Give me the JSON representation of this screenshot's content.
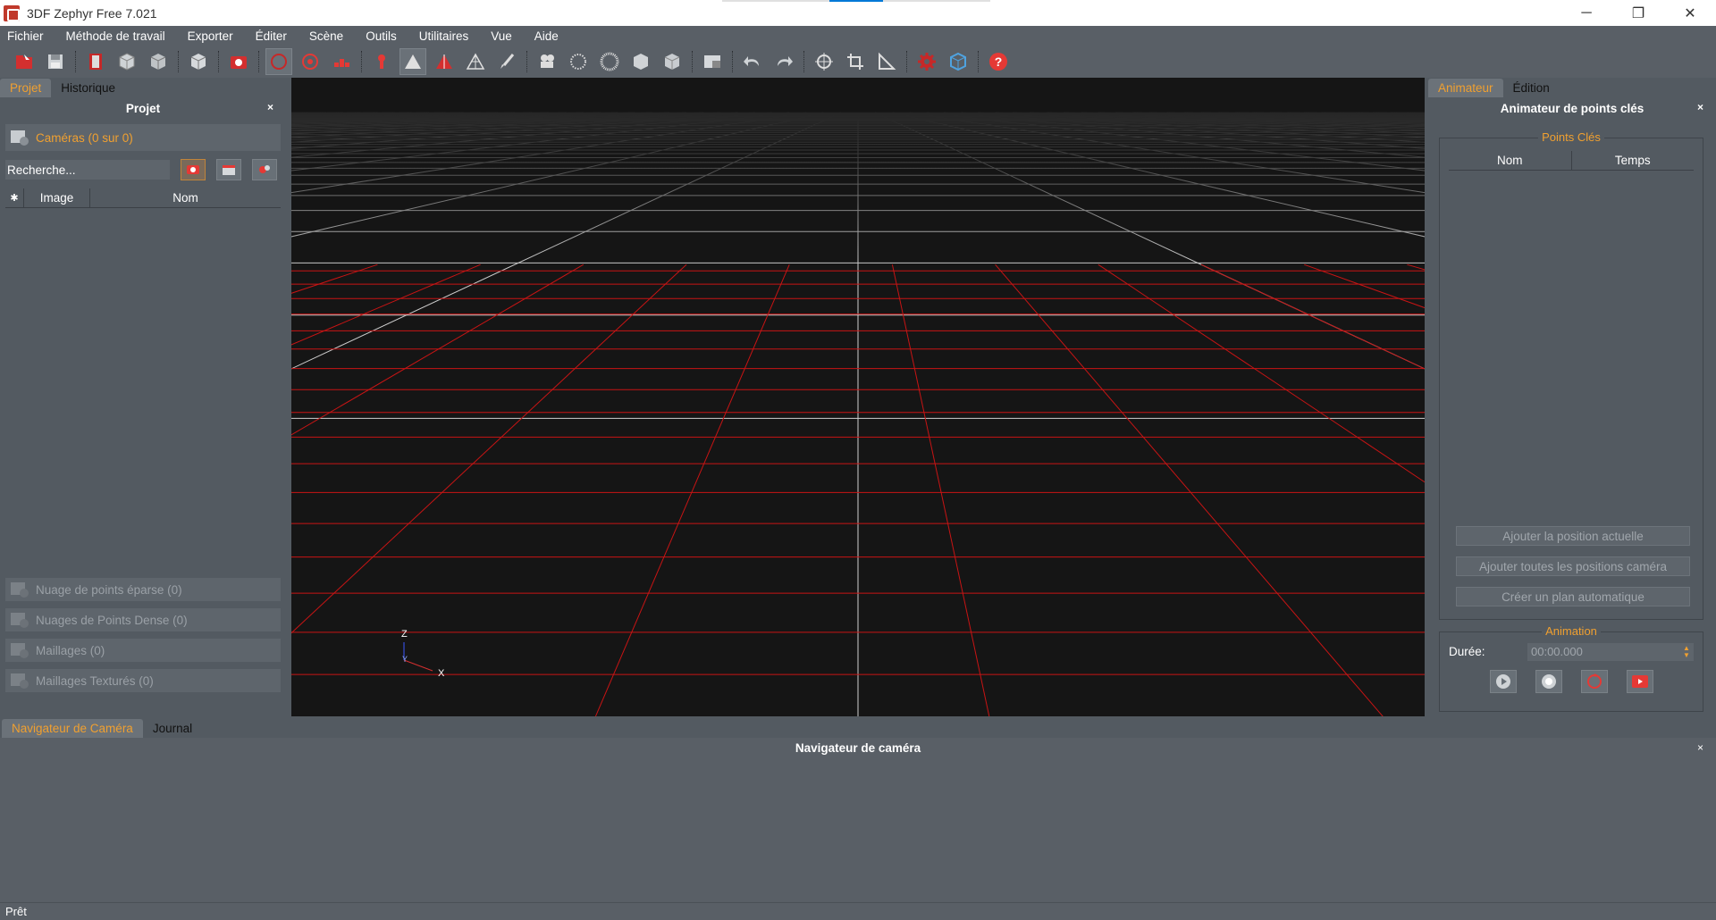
{
  "window": {
    "title": "3DF Zephyr Free 7.021",
    "controls": [
      "─",
      "❐",
      "✕"
    ]
  },
  "menubar": [
    "Fichier",
    "Méthode de travail",
    "Exporter",
    "Éditer",
    "Scène",
    "Outils",
    "Utilitaires",
    "Vue",
    "Aide"
  ],
  "toolbar": {
    "icons": [
      "new-project-icon",
      "save-icon",
      "film-icon",
      "cube-icon",
      "cube-solid-icon",
      "export-cube-icon",
      "camera-icon",
      "orbit-icon",
      "target-icon",
      "sparse-points-icon",
      "mesh-icon",
      "triangle-icon",
      "triangle-red-icon",
      "triangle-outline-icon",
      "brush-icon",
      "camera-rig-icon",
      "points-icon",
      "dense-points-icon",
      "solid-cube-icon",
      "textured-cube-icon",
      "window-icon",
      "undo-icon",
      "redo-icon",
      "rotate-icon",
      "crop-icon",
      "ruler-icon",
      "settings-icon",
      "view-cube-icon",
      "help-icon"
    ]
  },
  "left_panel": {
    "tabs": [
      "Projet",
      "Historique"
    ],
    "title": "Projet",
    "close": "×",
    "cameras_label": "Caméras (0 sur 0)",
    "search_placeholder": "Recherche...",
    "columns": {
      "star": "✱",
      "image": "Image",
      "name": "Nom"
    },
    "sections": [
      "Nuage de points éparse (0)",
      "Nuages de Points Dense (0)",
      "Maillages (0)",
      "Maillages Texturés (0)"
    ]
  },
  "viewport": {
    "axis_labels": {
      "z": "Z",
      "y": "Y",
      "x": "X"
    }
  },
  "right_panel": {
    "tabs": [
      "Animateur",
      "Édition"
    ],
    "title": "Animateur de points clés",
    "close": "×",
    "keyframes_group": "Points Clés",
    "columns": [
      "Nom",
      "Temps"
    ],
    "buttons": [
      "Ajouter la position actuelle",
      "Ajouter toutes les positions caméra",
      "Créer un plan automatique"
    ],
    "animation_group": "Animation",
    "duration_label": "Durée:",
    "duration_value": "00:00.000"
  },
  "bottom_panel": {
    "tabs": [
      "Navigateur de Caméra",
      "Journal"
    ],
    "title": "Navigateur de caméra",
    "close": "×"
  },
  "status": "Prêt",
  "colors": {
    "accent": "#f0a030",
    "grid_red": "#c81414",
    "panel": "#535a61"
  }
}
